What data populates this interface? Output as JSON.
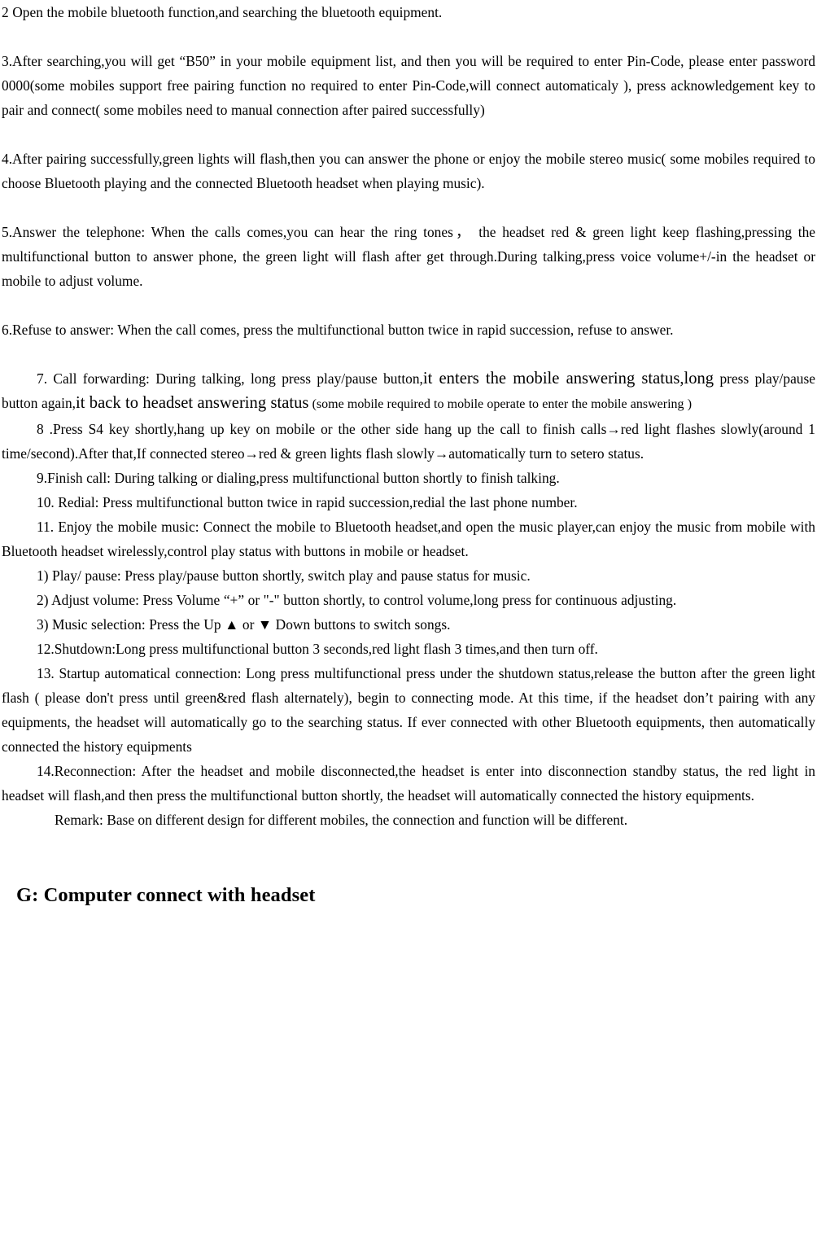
{
  "document": {
    "type": "bluetooth-headset-user-manual-page",
    "device_name": "B50",
    "paragraphs": {
      "item2": "2 Open the mobile bluetooth function,and searching the bluetooth equipment.",
      "item3": "3.After searching,you will get “B50” in your mobile equipment list, and then you will be required to enter Pin-Code, please enter password 0000(some mobiles support free pairing function no required to enter Pin-Code,will connect automaticaly ), press acknowledgement key to pair and connect( some mobiles need to manual connection after paired successfully)",
      "item4": "4.After pairing successfully,green lights will flash,then you can answer the phone or enjoy the mobile stereo music( some mobiles required to choose Bluetooth playing and the connected Bluetooth headset when playing music).",
      "item5": "5.Answer the telephone: When the calls comes,you can hear the ring tones， the headset red & green light keep flashing,pressing the multifunctional button to answer phone, the green light will flash after get through.During talking,press voice volume+/-in the headset or mobile to adjust volume.",
      "item6": "6.Refuse to answer: When the call comes, press the multifunctional button twice in rapid succession, refuse to answer.",
      "item7_part1": "7. Call forwarding: During talking, long press play/pause button,",
      "item7_big1": "it enters the mobile answering status,long",
      "item7_part2": " press play/pause button again,",
      "item7_big2": "it back to headset answering status",
      "item7_small": " (some mobile required to mobile operate to enter the mobile answering )",
      "item8": "8 .Press S4 key shortly,hang up key on mobile or the other side hang up the call to finish calls→red light flashes slowly(around 1 time/second).After that,If connected stereo→red & green lights flash slowly→automatically turn to setero status.",
      "item9": "9.Finish call: During talking or dialing,press multifunctional button shortly to finish talking.",
      "item10": "10. Redial: Press multifunctional button twice in rapid succession,redial the last phone number.",
      "item11": "11. Enjoy the mobile music: Connect the mobile to Bluetooth headset,and open the music player,can enjoy the music from mobile with Bluetooth headset wirelessly,control play status with buttons in mobile or headset.",
      "item11_sub1": "1) Play/ pause: Press play/pause button shortly, switch play and pause status for music.",
      "item11_sub2": "2) Adjust volume: Press Volume “+”  or \"-\" button shortly, to control volume,long press for continuous adjusting.",
      "item11_sub3": "3) Music selection: Press the Up ▲ or ▼ Down buttons to switch songs.",
      "item12": "12.Shutdown:Long press multifunctional button 3 seconds,red light flash 3 times,and then turn off.",
      "item13": "13. Startup automatical connection: Long press multifunctional press under the shutdown status,release the button after the green light flash ( please don't press until green&red flash alternately), begin to connecting mode. At this time, if the headset don’t pairing with any equipments, the headset will automatically go to the searching status. If ever connected with other Bluetooth equipments, then automatically connected the history equipments",
      "item14": "14.Reconnection: After the headset and mobile disconnected,the headset is enter into disconnection standby status, the red light in headset will flash,and then press the multifunctional button shortly, the headset will automatically connected the history equipments.",
      "remark": "Remark: Base on different design for different mobiles, the connection and function will be different."
    },
    "heading": {
      "section_g": "G: Computer connect with headset"
    },
    "colors": {
      "text": "#000000",
      "background": "#ffffff"
    }
  }
}
